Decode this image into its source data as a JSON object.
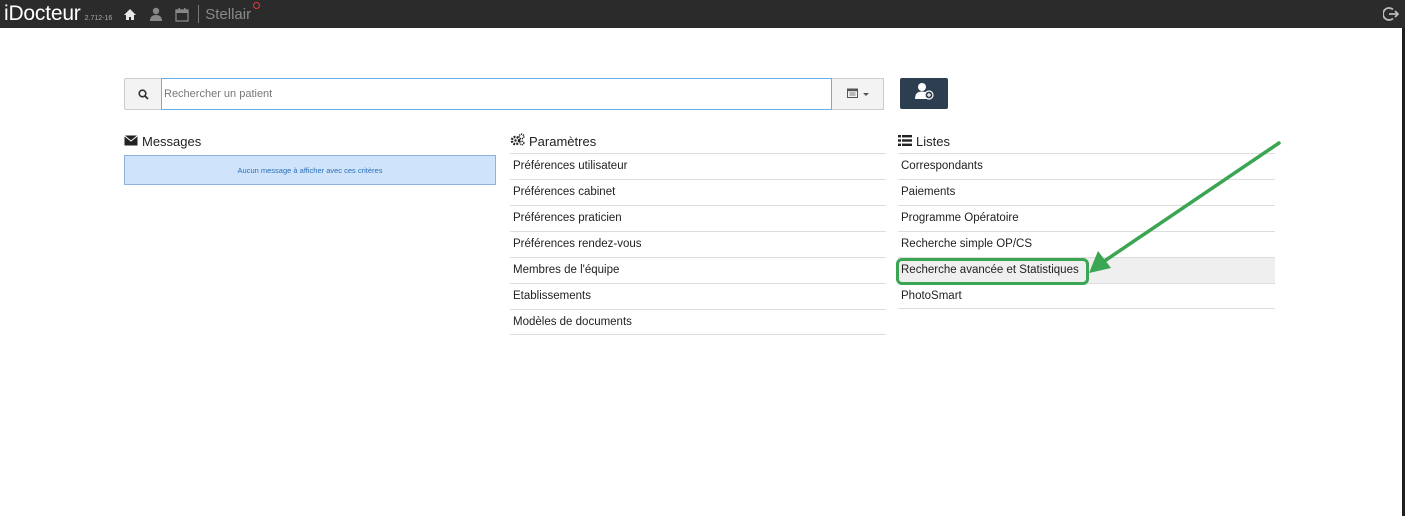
{
  "app": {
    "title": "iDocteur",
    "version": "2.712-16",
    "stellair": "Stellair"
  },
  "search": {
    "placeholder": "Rechercher un patient",
    "value": ""
  },
  "messages": {
    "title": "Messages",
    "empty": "Aucun message à afficher avec ces critères"
  },
  "parametres": {
    "title": "Paramètres",
    "items": [
      "Préférences utilisateur",
      "Préférences cabinet",
      "Préférences praticien",
      "Préférences rendez-vous",
      "Membres de l'équipe",
      "Etablissements",
      "Modèles de documents"
    ]
  },
  "listes": {
    "title": "Listes",
    "items": [
      "Correspondants",
      "Paiements",
      "Programme Opératoire",
      "Recherche simple OP/CS",
      "Recherche avancée et Statistiques",
      "PhotoSmart"
    ]
  },
  "colors": {
    "topbar": "#2b2b2b",
    "annotation": "#3aa552",
    "accent": "#2c3e50",
    "alert_bg": "#cfe3fb"
  },
  "icons": [
    "home-icon",
    "user-icon",
    "calendar-icon",
    "logout-icon",
    "search-icon",
    "add-user-icon",
    "envelope-icon",
    "cogs-icon",
    "list-icon"
  ]
}
